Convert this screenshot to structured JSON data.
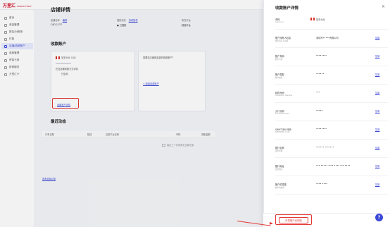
{
  "logo": {
    "text": "万里汇",
    "sub": "WORLD FIRST"
  },
  "sidebar": {
    "items": [
      {
        "label": "首页",
        "icon": "home-icon",
        "active": false
      },
      {
        "label": "资金管理",
        "icon": "wallet-icon",
        "active": false
      },
      {
        "label": "报告/对账单",
        "icon": "report-icon",
        "active": false
      },
      {
        "label": "付款",
        "icon": "pay-icon",
        "active": false
      },
      {
        "label": "店铺/收款账户",
        "icon": "store-icon",
        "active": true
      },
      {
        "label": "收款管理",
        "icon": "receive-icon",
        "active": false
      },
      {
        "label": "贸易卡券",
        "icon": "ticket-icon",
        "active": false
      },
      {
        "label": "财税服务",
        "icon": "tax-icon",
        "active": false
      },
      {
        "label": "万里汇卡",
        "icon": "card-icon",
        "active": false
      }
    ]
  },
  "page": {
    "title": "店铺详情",
    "info": [
      {
        "label": "店铺名称",
        "value": "CAD 1137",
        "link": "编辑"
      },
      {
        "label": "授权状态",
        "value": "● 已授权",
        "link": "查看授权"
      },
      {
        "label": "所在平台",
        "value": "其他平台"
      }
    ],
    "accounts_title": "收款账户",
    "account_card": {
      "currency": "加拿大元 CAD",
      "desc": "在此店铺收款方式详情",
      "status": "已启用",
      "link": "收款账户详情"
    },
    "add_card": {
      "text": "需要在店铺绑定新的收款账户？",
      "link": "+ 新增收款账户"
    },
    "activity_title": "最近动态",
    "table_headers": [
      "订单日期",
      "描述",
      "交易平台名称",
      "币种",
      "到账金额"
    ],
    "empty_text": "最近三个月内暂无交易记录",
    "bottom_link": "查看全部记录"
  },
  "panel": {
    "title": "收款账户详情",
    "close": "×",
    "fields": [
      {
        "label": "币种",
        "sub": "Currency",
        "value": "加拿大元",
        "copy": ""
      },
      {
        "label": "账户持有人姓名",
        "sub": "账户持有人名称",
        "value": "深圳市•••••有限公司",
        "copy": "复制"
      },
      {
        "label": "账户号码",
        "sub": "账户号码",
        "value": "••••••••",
        "copy": "复制"
      },
      {
        "label": "账户类型",
        "sub": "账户类型",
        "value": "••••••",
        "copy": "复制"
      },
      {
        "label": "机构代码",
        "sub": "Institution Number",
        "value": "•••",
        "copy": "复制"
      },
      {
        "label": "分行代码",
        "sub": "Transit Number",
        "value": "•••••",
        "copy": "复制"
      },
      {
        "label": "SWIFT/BIC代码",
        "sub": "SWIFT/BIC Code",
        "value": "••••••••",
        "copy": "复制"
      },
      {
        "label": "银行名称",
        "sub": "银行名称",
        "value": "•••••• •••••••",
        "copy": "复制"
      },
      {
        "label": "银行地址",
        "sub": "银行地址",
        "value": "••• ••••• •••• •••• ••• ••••",
        "copy": "复制"
      },
      {
        "label": "账户的类型",
        "sub": "账户的类型",
        "value": "•••• ••••",
        "copy": "复制"
      }
    ],
    "footer_button": "开具账户证明信",
    "help": "?"
  }
}
